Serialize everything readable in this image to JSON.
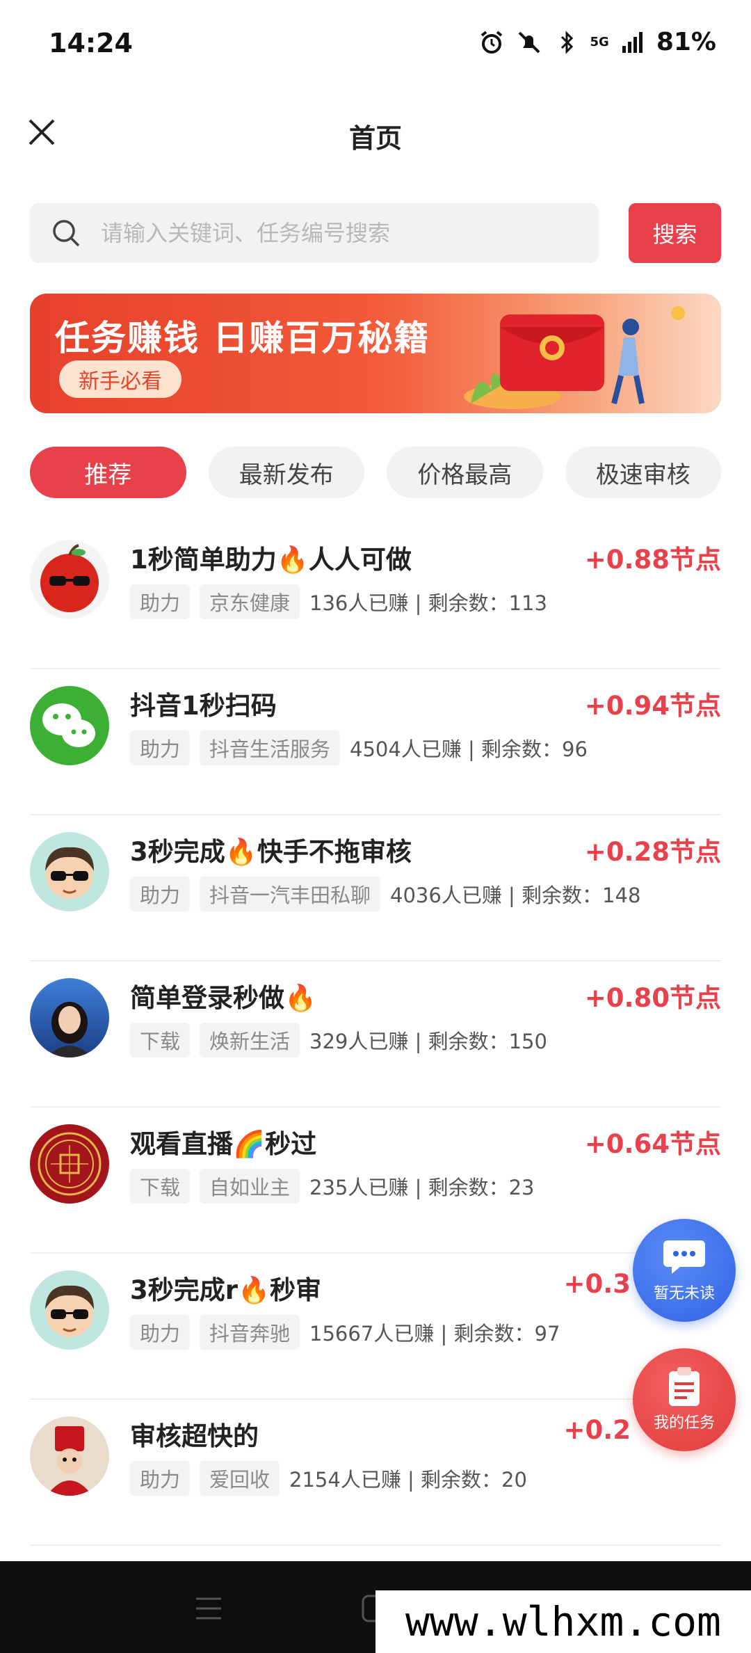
{
  "status_bar": {
    "time": "14:24",
    "network": "5G",
    "battery": "81%"
  },
  "header": {
    "title": "首页"
  },
  "search": {
    "placeholder": "请输入关键词、任务编号搜索",
    "button_label": "搜索"
  },
  "banner": {
    "title": "任务赚钱  日赚百万秘籍",
    "tag": "新手必看"
  },
  "tabs": [
    {
      "label": "推荐",
      "active": true
    },
    {
      "label": "最新发布",
      "active": false
    },
    {
      "label": "价格最高",
      "active": false
    },
    {
      "label": "极速审核",
      "active": false
    }
  ],
  "tasks": [
    {
      "title": "1秒简单助力🔥人人可做",
      "reward": "+0.88节点",
      "chips": [
        "助力",
        "京东健康"
      ],
      "stats": "136人已赚 | 剩余数：113",
      "avatar": "apple-sunglasses"
    },
    {
      "title": "抖音1秒扫码",
      "reward": "+0.94节点",
      "chips": [
        "助力",
        "抖音生活服务"
      ],
      "stats": "4504人已赚 | 剩余数：96",
      "avatar": "wechat-logo"
    },
    {
      "title": "3秒完成🔥快手不拖审核",
      "reward": "+0.28节点",
      "chips": [
        "助力",
        "抖音一汽丰田私聊"
      ],
      "stats": "4036人已赚 | 剩余数：148",
      "avatar": "cartoon-boy"
    },
    {
      "title": "简单登录秒做🔥",
      "reward": "+0.80节点",
      "chips": [
        "下载",
        "焕新生活"
      ],
      "stats": "329人已赚 | 剩余数：150",
      "avatar": "girl-photo"
    },
    {
      "title": "观看直播🌈秒过",
      "reward": "+0.64节点",
      "chips": [
        "下载",
        "自如业主"
      ],
      "stats": "235人已赚 | 剩余数：23",
      "avatar": "red-seal"
    },
    {
      "title": "3秒完成r🔥秒审",
      "reward": "+0.3",
      "chips": [
        "助力",
        "抖音奔驰"
      ],
      "stats": "15667人已赚 | 剩余数：97",
      "avatar": "cartoon-boy"
    },
    {
      "title": "审核超快的",
      "reward": "+0.2",
      "chips": [
        "助力",
        "爱回收"
      ],
      "stats": "2154人已赚 | 剩余数：20",
      "avatar": "festive-figure"
    }
  ],
  "fabs": {
    "messages_label": "暂无未读",
    "tasks_label": "我的任务"
  },
  "watermark": "www.wlhxm.com",
  "colors": {
    "accent": "#e8414c",
    "fab_blue": "#2f62e6",
    "fab_red": "#e23b3b"
  }
}
